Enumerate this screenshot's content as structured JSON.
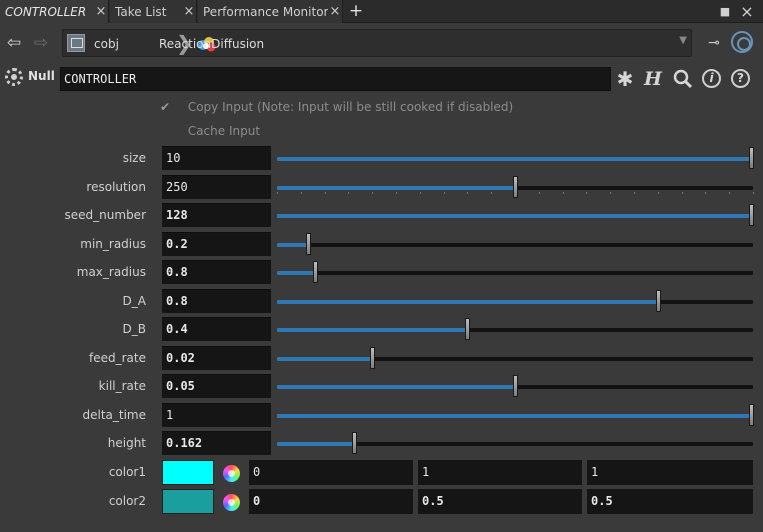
{
  "tabs": [
    {
      "label": "CONTROLLER",
      "close": "×",
      "active": true
    },
    {
      "label": "Take List",
      "close": "×",
      "active": false
    },
    {
      "label": "Performance Monitor",
      "close": "×",
      "active": false
    }
  ],
  "new_tab_label": "+",
  "window_controls": {
    "maximize": "■",
    "close": "×"
  },
  "path": {
    "segments": [
      "obj",
      "ReactionDiffusion"
    ],
    "first_segment_prefix": "c",
    "separator": "❯"
  },
  "node": {
    "type": "Null",
    "name": "CONTROLLER"
  },
  "header_icons": {
    "gear": "✱",
    "help_h": "H",
    "info": "i",
    "help": "?"
  },
  "toggles": {
    "copy_input": {
      "label": "Copy Input (Note: Input will be still cooked if disabled)",
      "checked": true
    },
    "cache_input": {
      "label": "Cache Input",
      "checked": false
    }
  },
  "parameters": [
    {
      "label": "size",
      "value": "10",
      "bold": false,
      "fraction": 1.0,
      "ticks": false
    },
    {
      "label": "resolution",
      "value": "250",
      "bold": false,
      "fraction": 0.5,
      "ticks": true
    },
    {
      "label": "seed_number",
      "value": "128",
      "bold": true,
      "fraction": 1.0,
      "ticks": false
    },
    {
      "label": "min_radius",
      "value": "0.2",
      "bold": true,
      "fraction": 0.065,
      "ticks": false
    },
    {
      "label": "max_radius",
      "value": "0.8",
      "bold": true,
      "fraction": 0.08,
      "ticks": false
    },
    {
      "label": "D_A",
      "value": "0.8",
      "bold": true,
      "fraction": 0.8,
      "ticks": false
    },
    {
      "label": "D_B",
      "value": "0.4",
      "bold": true,
      "fraction": 0.4,
      "ticks": false
    },
    {
      "label": "feed_rate",
      "value": "0.02",
      "bold": true,
      "fraction": 0.2,
      "ticks": false
    },
    {
      "label": "kill_rate",
      "value": "0.05",
      "bold": true,
      "fraction": 0.5,
      "ticks": false
    },
    {
      "label": "delta_time",
      "value": "1",
      "bold": false,
      "fraction": 1.0,
      "ticks": false
    },
    {
      "label": "height",
      "value": "0.162",
      "bold": true,
      "fraction": 0.162,
      "ticks": false
    }
  ],
  "colors": [
    {
      "label": "color1",
      "swatch": "#00ffff",
      "values": [
        "0",
        "1",
        "1"
      ],
      "bold": false
    },
    {
      "label": "color2",
      "swatch": "#1a9e9e",
      "values": [
        "0",
        "0.5",
        "0.5"
      ],
      "bold": true
    }
  ],
  "accent": "#2f78b3"
}
